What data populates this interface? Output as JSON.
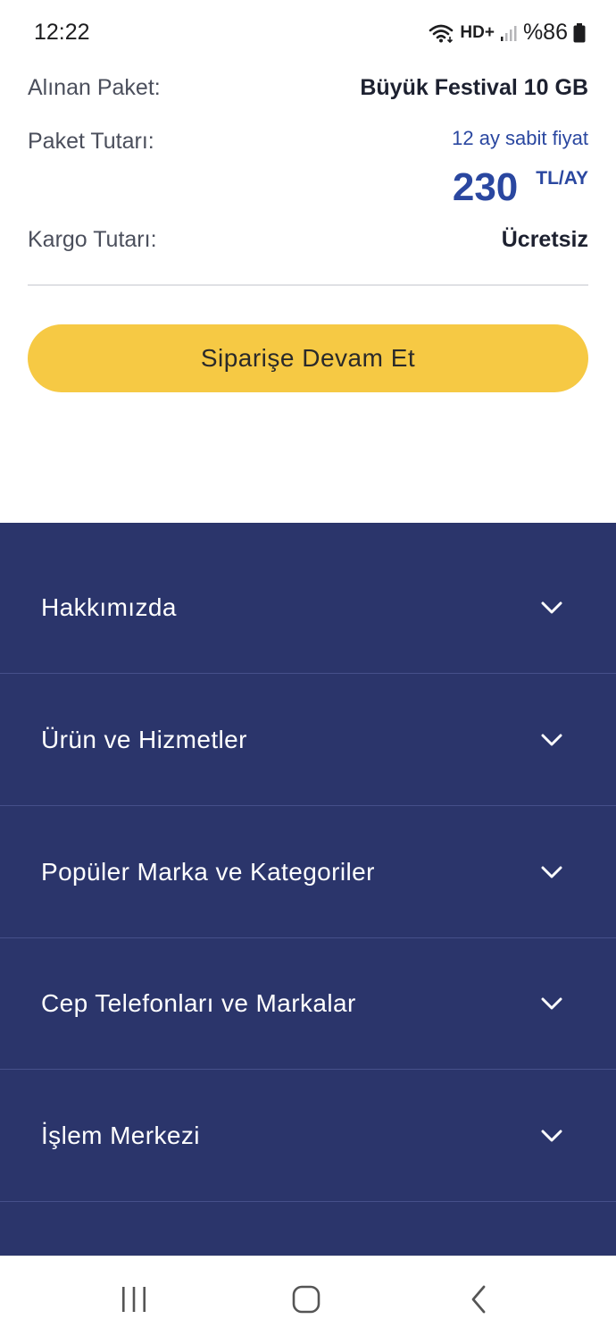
{
  "status_bar": {
    "time": "12:22",
    "network": "HD+",
    "battery": "%86"
  },
  "summary": {
    "package_label": "Alınan Paket:",
    "package_value": "Büyük Festival 10 GB",
    "price_label": "Paket Tutarı:",
    "price_note": "12 ay sabit fiyat",
    "price_amount": "230",
    "price_unit": "TL/AY",
    "shipping_label": "Kargo Tutarı:",
    "shipping_value": "Ücretsiz"
  },
  "cta": {
    "label": "Siparişe Devam Et"
  },
  "footer": {
    "items": [
      {
        "label": "Hakkımızda"
      },
      {
        "label": "Ürün ve Hizmetler"
      },
      {
        "label": "Popüler Marka ve Kategoriler"
      },
      {
        "label": "Cep Telefonları ve Markalar"
      },
      {
        "label": "İşlem Merkezi"
      }
    ]
  },
  "colors": {
    "accent_yellow": "#f6c944",
    "footer_navy": "#2b356b",
    "price_blue": "#2a47a0"
  },
  "icons": {
    "wifi": "wifi-icon",
    "signal": "signal-icon",
    "battery": "battery-icon",
    "chevron": "chevron-down-icon",
    "recent": "recent-apps-icon",
    "home": "home-icon",
    "back": "back-icon"
  }
}
